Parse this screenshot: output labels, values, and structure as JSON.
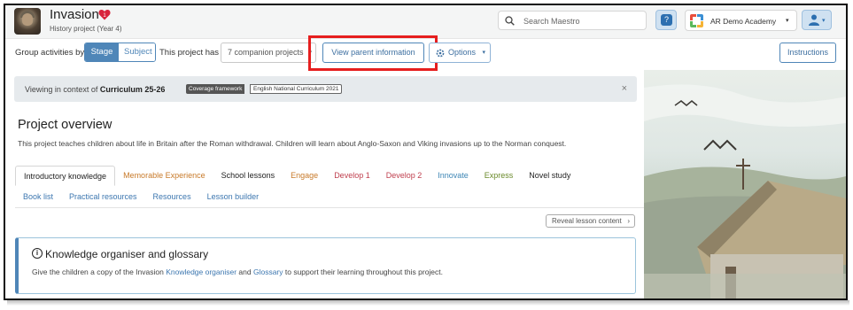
{
  "project": {
    "title": "Invasion",
    "badge_count": "1",
    "subtitle": "History project (Year 4)"
  },
  "header": {
    "search_placeholder": "Search Maestro",
    "help_label": "?",
    "org_name": "AR Demo Academy"
  },
  "toolbar": {
    "group_label": "Group activities by",
    "group_options": [
      "Stage",
      "Subject"
    ],
    "selected_group": "Stage",
    "has_label": "This project has",
    "companion_label": "7 companion projects",
    "parent_button": "View parent information",
    "options_button": "Options",
    "instructions_button": "Instructions"
  },
  "context_banner": {
    "prefix": "Viewing in context of ",
    "curriculum": "Curriculum 25-26",
    "framework_tag": "Coverage framework",
    "framework_name": "English National Curriculum 2021",
    "close": "×"
  },
  "overview": {
    "title": "Project overview",
    "description": "This project teaches children about life in Britain after the Roman withdrawal. Children will learn about Anglo-Saxon and Viking invasions up to the Norman conquest."
  },
  "tabs_row1": [
    {
      "label": "Introductory knowledge",
      "color": "#222222",
      "active": true
    },
    {
      "label": "Memorable Experience",
      "color": "#c87a2a"
    },
    {
      "label": "School lessons",
      "color": "#222222"
    },
    {
      "label": "Engage",
      "color": "#c87a2a"
    },
    {
      "label": "Develop 1",
      "color": "#c0404f"
    },
    {
      "label": "Develop 2",
      "color": "#c0404f"
    },
    {
      "label": "Innovate",
      "color": "#3d86b5"
    },
    {
      "label": "Express",
      "color": "#6a8a2a"
    },
    {
      "label": "Novel study",
      "color": "#222222"
    }
  ],
  "tabs_row2": [
    {
      "label": "Book list",
      "color": "#3d77b0"
    },
    {
      "label": "Practical resources",
      "color": "#3d77b0"
    },
    {
      "label": "Resources",
      "color": "#3d77b0"
    },
    {
      "label": "Lesson builder",
      "color": "#3d77b0"
    }
  ],
  "reveal_button": "Reveal lesson content",
  "knowledge_card": {
    "title": "Knowledge organiser and glossary",
    "text_before": "Give the children a copy of the Invasion ",
    "link1": "Knowledge organiser",
    "text_middle": " and ",
    "link2": "Glossary",
    "text_after": " to support their learning throughout this project."
  },
  "colors": {
    "accent": "#4f86b8",
    "highlight": "#e61e1e"
  }
}
